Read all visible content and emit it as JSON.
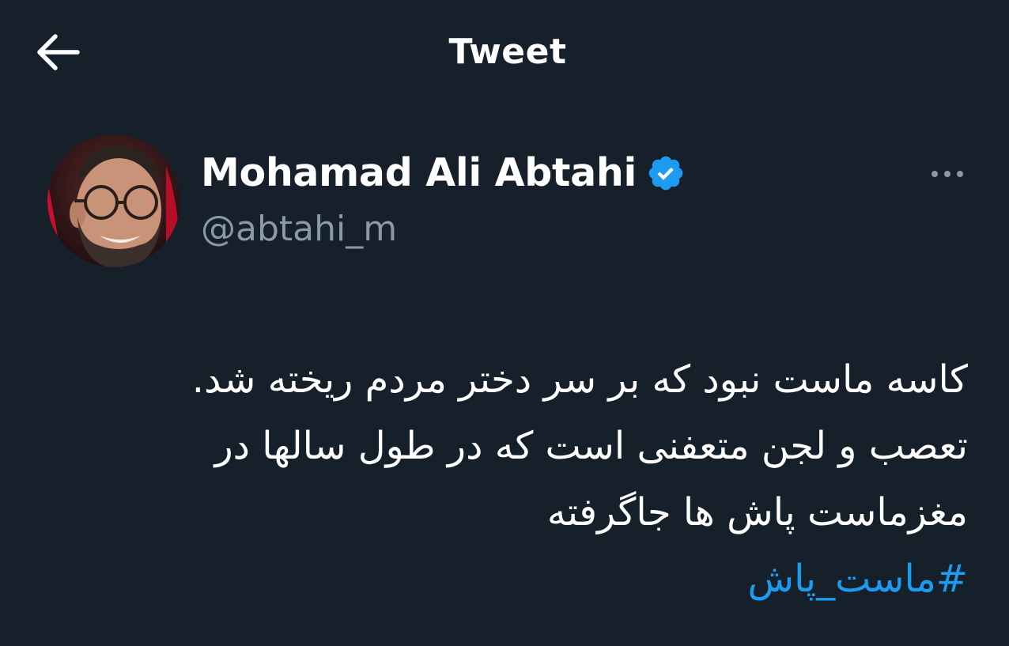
{
  "header": {
    "title": "Tweet",
    "back_icon": "arrow-left-icon"
  },
  "author": {
    "display_name": "Mohamad Ali Abtahi",
    "handle": "@abtahi_m",
    "verified_icon": "verified-badge-icon",
    "more_icon": "more-horizontal-icon"
  },
  "tweet": {
    "lines": [
      "کاسه ماست نبود که بر سر دختر مردم ریخته شد.",
      "تعصب و لجن متعفنی است که در طول سالها در",
      "مغزماست پاش ها جاگرفته"
    ],
    "hashtag": "#ماست_پاش"
  },
  "colors": {
    "background": "#15202b",
    "text": "#ffffff",
    "secondary_text": "#8b98a5",
    "accent": "#1d9bf0"
  }
}
